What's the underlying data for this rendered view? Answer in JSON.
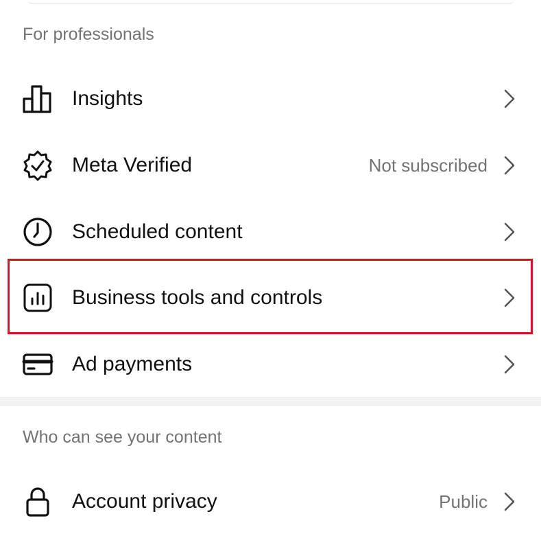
{
  "sections": [
    {
      "title": "For professionals",
      "items": [
        {
          "label": "Insights",
          "value": "",
          "icon": "bar-chart-icon"
        },
        {
          "label": "Meta Verified",
          "value": "Not subscribed",
          "icon": "verified-badge-icon"
        },
        {
          "label": "Scheduled content",
          "value": "",
          "icon": "clock-icon"
        },
        {
          "label": "Business tools and controls",
          "value": "",
          "icon": "business-tools-icon"
        },
        {
          "label": "Ad payments",
          "value": "",
          "icon": "credit-card-icon"
        }
      ]
    },
    {
      "title": "Who can see your content",
      "items": [
        {
          "label": "Account privacy",
          "value": "Public",
          "icon": "lock-icon"
        }
      ]
    }
  ],
  "highlight": {
    "target": "Business tools and controls",
    "color": "#d9121f"
  },
  "colors": {
    "text": "#111111",
    "secondary_text": "#737373",
    "divider": "#f2f2f2"
  }
}
